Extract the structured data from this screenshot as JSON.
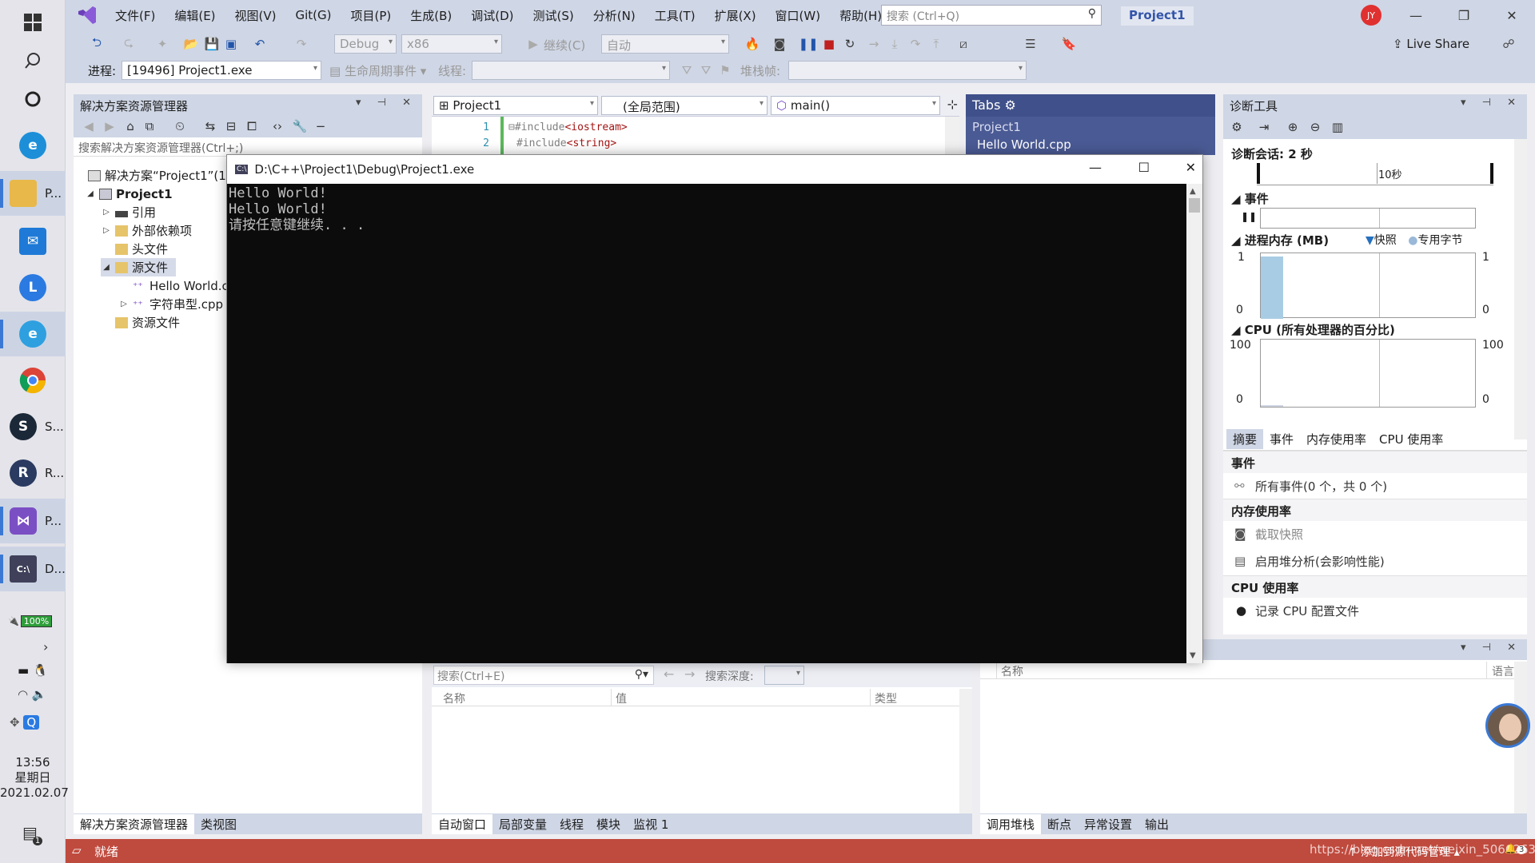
{
  "taskbar": {
    "apps": [
      {
        "label": "P...",
        "icon": "folder-icon",
        "color": "#e8b84a"
      },
      {
        "label": "",
        "icon": "mail-icon",
        "color": "#1e7ad6"
      },
      {
        "label": "",
        "icon": "l-app-icon",
        "color": "#2a7ae2"
      },
      {
        "label": "",
        "icon": "edge-icon",
        "color": "#2ea0e0"
      },
      {
        "label": "",
        "icon": "chrome-icon",
        "color": "#e0a020"
      },
      {
        "label": "S...",
        "icon": "steam-icon",
        "color": "#1b2838"
      },
      {
        "label": "R...",
        "icon": "r-app-icon",
        "color": "#2a3a60"
      },
      {
        "label": "P...",
        "icon": "visual-studio-icon",
        "color": "#7b4fc4"
      },
      {
        "label": "D...",
        "icon": "console-icon",
        "color": "#40405a"
      }
    ],
    "battery": "100%",
    "time": "13:56",
    "weekday": "星期日",
    "date": "2021.02.07",
    "notification_count": "1"
  },
  "menu": [
    "文件(F)",
    "编辑(E)",
    "视图(V)",
    "Git(G)",
    "项目(P)",
    "生成(B)",
    "调试(D)",
    "测试(S)",
    "分析(N)",
    "工具(T)",
    "扩展(X)",
    "窗口(W)",
    "帮助(H)"
  ],
  "search": {
    "placeholder": "搜索 (Ctrl+Q)"
  },
  "project_title": "Project1",
  "avatar_initials": "JY",
  "live_share": "Live Share",
  "toolbar": {
    "config": "Debug",
    "platform": "x86",
    "continue": "继续(C)",
    "auto": "自动"
  },
  "toolbar2": {
    "process_label": "进程:",
    "process_value": "[19496] Project1.exe",
    "lifecycle": "生命周期事件",
    "thread_label": "线程:",
    "stackframe_label": "堆栈帧:"
  },
  "solution_explorer": {
    "title": "解决方案资源管理器",
    "search_placeholder": "搜索解决方案资源管理器(Ctrl+;)",
    "items": [
      {
        "label": "解决方案“Project1”(1"
      },
      {
        "label": "Project1"
      },
      {
        "label": "引用"
      },
      {
        "label": "外部依赖项"
      },
      {
        "label": "头文件"
      },
      {
        "label": "源文件"
      },
      {
        "label": "Hello World.cpp"
      },
      {
        "label": "字符串型.cpp"
      },
      {
        "label": "资源文件"
      }
    ],
    "tabs": [
      "解决方案资源管理器",
      "类视图"
    ]
  },
  "editor": {
    "project_combo": "Project1",
    "scope_combo": "(全局范围)",
    "func_combo": "main()",
    "lines": [
      {
        "num": "1",
        "kw": "#include",
        "lib": "<iostream>"
      },
      {
        "num": "2",
        "kw": "#include",
        "lib": "<string>"
      }
    ]
  },
  "tabs_panel": {
    "title": "Tabs",
    "project": "Project1",
    "file": "Hello World.cpp"
  },
  "console": {
    "title": "D:\\C++\\Project1\\Debug\\Project1.exe",
    "lines": [
      "Hello World!",
      "Hello World!",
      "请按任意键继续. . ."
    ]
  },
  "diagnostics": {
    "title": "诊断工具",
    "session": "诊断会话: 2 秒",
    "timeline_label": "10秒",
    "events_label": "事件",
    "memory_label": "进程内存 (MB)",
    "snapshot_legend": "快照",
    "private_bytes_legend": "专用字节",
    "mem_max": "1",
    "mem_min": "0",
    "cpu_label": "CPU (所有处理器的百分比)",
    "cpu_max": "100",
    "cpu_min": "0",
    "tabs": [
      "摘要",
      "事件",
      "内存使用率",
      "CPU 使用率"
    ],
    "summary_events_head": "事件",
    "all_events": "所有事件(0 个，共 0 个)",
    "memory_head": "内存使用率",
    "take_snapshot": "截取快照",
    "enable_heap": "启用堆分析(会影响性能)",
    "cpu_head": "CPU 使用率",
    "record_cpu": "记录 CPU 配置文件"
  },
  "autos": {
    "search_placeholder": "搜索(Ctrl+E)",
    "depth_label": "搜索深度:",
    "columns": [
      "名称",
      "值",
      "类型"
    ],
    "tabs": [
      "自动窗口",
      "局部变量",
      "线程",
      "模块",
      "监视 1"
    ]
  },
  "callstack": {
    "columns": [
      "名称",
      "语言"
    ],
    "tabs": [
      "调用堆栈",
      "断点",
      "异常设置",
      "输出"
    ]
  },
  "status": {
    "text": "就绪",
    "watermark": "https://blog.csdn.net/weixin_50662634",
    "source_control": "添加到源代码管理",
    "badge": "3"
  },
  "colors": {
    "status_bar": "#bf4a3e",
    "accent": "#40508a"
  }
}
